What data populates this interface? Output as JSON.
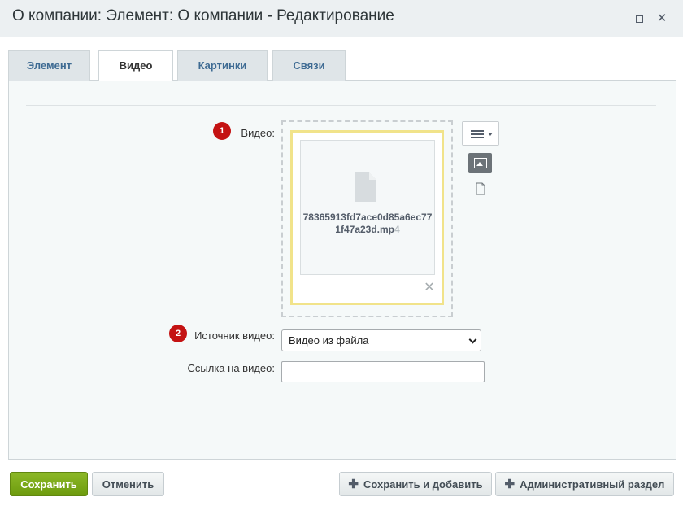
{
  "window": {
    "title": "О компании: Элемент: О компании - Редактирование"
  },
  "tabs": [
    {
      "label": "Элемент",
      "active": false
    },
    {
      "label": "Видео",
      "active": true
    },
    {
      "label": "Картинки",
      "active": false
    },
    {
      "label": "Связи",
      "active": false
    }
  ],
  "form": {
    "video": {
      "badge": "1",
      "label": "Видео:",
      "file_name": "78365913fd7ace0d85a6ec771f47a23d.mp",
      "file_ext": "4"
    },
    "source": {
      "badge": "2",
      "label": "Источник видео:",
      "value": "Видео из файла"
    },
    "link": {
      "label": "Ссылка на видео:",
      "value": ""
    }
  },
  "footer": {
    "save_label": "Сохранить",
    "cancel_label": "Отменить",
    "save_add_label": "Сохранить и добавить",
    "admin_label": "Административный раздел"
  },
  "colors": {
    "badge": "#c41313",
    "save_button": "#7aa81a",
    "file_card_border": "#f1e38a",
    "tab_text": "#3e6b93"
  },
  "icons": {
    "maximize": "maximize-icon",
    "close": "close-icon",
    "document": "document-icon",
    "remove": "remove-icon",
    "menu": "menu-icon",
    "image_view": "image-view-icon",
    "file_view": "file-view-icon",
    "plus": "plus-icon"
  }
}
